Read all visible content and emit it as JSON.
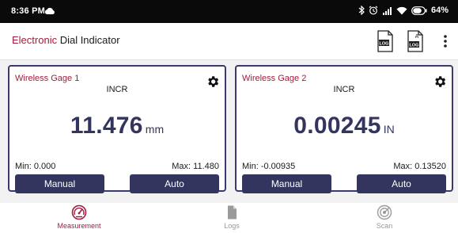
{
  "status_bar": {
    "time": "8:36 PM",
    "battery": "64%",
    "icons": [
      "cloud-icon",
      "bluetooth-icon",
      "alarm-icon",
      "signal-icon",
      "wifi-icon",
      "battery-icon"
    ]
  },
  "header": {
    "title_brand": "Electronic",
    "title_rest": " Dial Indicator",
    "brand_color": "#a31c3d",
    "actions": [
      "log-file-icon",
      "log-file-a-icon",
      "overflow-menu-icon"
    ],
    "log_badge": "LOG",
    "log_a_letter": "A"
  },
  "gages": [
    {
      "title": "Wireless Gage 1",
      "mode": "INCR",
      "value": "11.476",
      "unit": "mm",
      "min": "Min: 0.000",
      "max": "Max: 11.480",
      "manual_label": "Manual",
      "auto_label": "Auto"
    },
    {
      "title": "Wireless Gage 2",
      "mode": "INCR",
      "value": "0.00245",
      "unit": "IN",
      "min": "Min: -0.00935",
      "max": "Max: 0.13520",
      "manual_label": "Manual",
      "auto_label": "Auto"
    }
  ],
  "bottom_nav": {
    "items": [
      {
        "label": "Measurement",
        "icon": "gauge-icon",
        "active": true
      },
      {
        "label": "Logs",
        "icon": "document-icon",
        "active": false
      },
      {
        "label": "Scan",
        "icon": "scan-icon",
        "active": false
      }
    ]
  },
  "colors": {
    "accent": "#a31c3d",
    "primary": "#33355f",
    "status_bar_bg": "#0a0a0a"
  }
}
